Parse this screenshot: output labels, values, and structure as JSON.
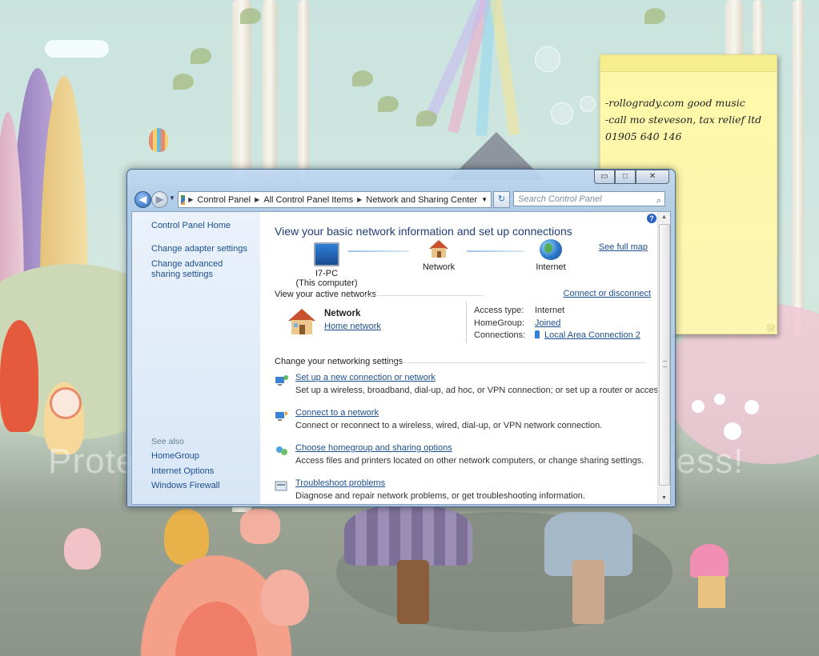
{
  "sticky_note": {
    "lines": [
      "-rollogrady.com good music",
      "-call mo steveson, tax relief ltd",
      "01905 640 146"
    ]
  },
  "window": {
    "caption_buttons": {
      "minimize": "▭",
      "maximize": "□",
      "close": "✕"
    },
    "address_bar": {
      "crumbs": [
        "Control Panel",
        "All Control Panel Items",
        "Network and Sharing Center"
      ]
    },
    "search_placeholder": "Search Control Panel",
    "left_pane": {
      "home": "Control Panel Home",
      "links": [
        "Change adapter settings",
        "Change advanced sharing settings"
      ],
      "see_also_label": "See also",
      "see_also": [
        "HomeGroup",
        "Internet Options",
        "Windows Firewall"
      ]
    },
    "main": {
      "heading": "View your basic network information and set up connections",
      "see_full_map": "See full map",
      "map": {
        "computer_name": "I7-PC",
        "computer_sub": "(This computer)",
        "network": "Network",
        "internet": "Internet"
      },
      "active_networks": {
        "header": "View your active networks",
        "connect_link": "Connect or disconnect",
        "network_name": "Network",
        "network_type": "Home network",
        "access_type_label": "Access type:",
        "access_type": "Internet",
        "homegroup_label": "HomeGroup:",
        "homegroup": "Joined",
        "connections_label": "Connections:",
        "connection": "Local Area Connection 2"
      },
      "settings": {
        "header": "Change your networking settings",
        "tasks": [
          {
            "title": "Set up a new connection or network",
            "desc": "Set up a wireless, broadband, dial-up, ad hoc, or VPN connection; or set up a router or access point."
          },
          {
            "title": "Connect to a network",
            "desc": "Connect or reconnect to a wireless, wired, dial-up, or VPN network connection."
          },
          {
            "title": "Choose homegroup and sharing options",
            "desc": "Access files and printers located on other network computers, or change sharing settings."
          },
          {
            "title": "Troubleshoot problems",
            "desc": "Diagnose and repair network problems, or get troubleshooting information."
          }
        ]
      }
    }
  },
  "watermark": {
    "left": "Prote",
    "right": "r less!"
  }
}
